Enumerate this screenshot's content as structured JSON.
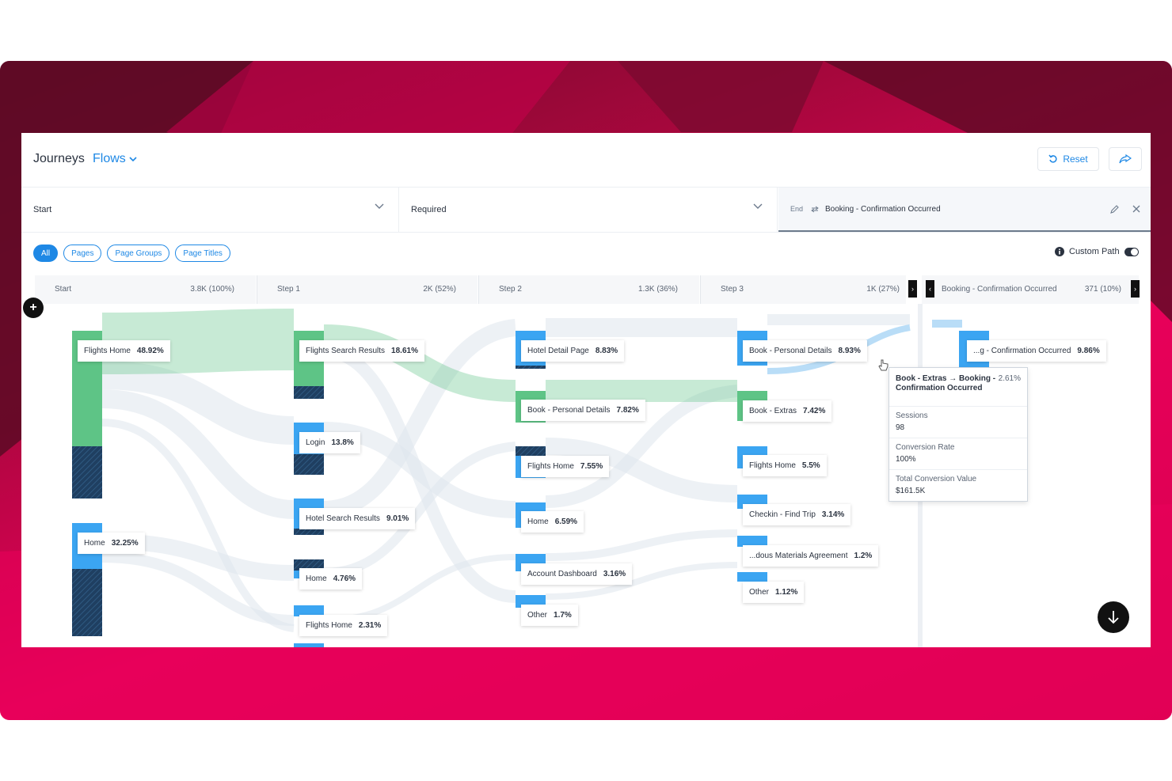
{
  "header": {
    "title": "Journeys",
    "view_label": "Flows",
    "reset_label": "Reset"
  },
  "filters": {
    "start_label": "Start",
    "required_label": "Required",
    "end_tag": "End",
    "end_value": "Booking - Confirmation Occurred"
  },
  "pills": [
    "All",
    "Pages",
    "Page Groups",
    "Page Titles"
  ],
  "custom_path_label": "Custom Path",
  "steps": [
    {
      "name": "Start",
      "count": "3.8K (100%)"
    },
    {
      "name": "Step 1",
      "count": "2K (52%)"
    },
    {
      "name": "Step 2",
      "count": "1.3K (36%)"
    },
    {
      "name": "Step 3",
      "count": "1K (27%)"
    },
    {
      "name": "Booking - Confirmation Occurred",
      "count": "371 (10%)"
    }
  ],
  "nav": {
    "next": "›",
    "prev": "‹"
  },
  "nodes": {
    "start": [
      {
        "label": "Flights Home",
        "pct": "48.92%"
      },
      {
        "label": "Home",
        "pct": "32.25%"
      }
    ],
    "step1": [
      {
        "label": "Flights Search Results",
        "pct": "18.61%"
      },
      {
        "label": "Login",
        "pct": "13.8%"
      },
      {
        "label": "Hotel Search Results",
        "pct": "9.01%"
      },
      {
        "label": "Home",
        "pct": "4.76%"
      },
      {
        "label": "Flights Home",
        "pct": "2.31%"
      }
    ],
    "step2": [
      {
        "label": "Hotel Detail Page",
        "pct": "8.83%"
      },
      {
        "label": "Book - Personal Details",
        "pct": "7.82%"
      },
      {
        "label": "Flights Home",
        "pct": "7.55%"
      },
      {
        "label": "Home",
        "pct": "6.59%"
      },
      {
        "label": "Account Dashboard",
        "pct": "3.16%"
      },
      {
        "label": "Other",
        "pct": "1.7%"
      }
    ],
    "step3": [
      {
        "label": "Book - Personal Details",
        "pct": "8.93%"
      },
      {
        "label": "Book - Extras",
        "pct": "7.42%"
      },
      {
        "label": "Flights Home",
        "pct": "5.5%"
      },
      {
        "label": "Checkin - Find Trip",
        "pct": "3.14%"
      },
      {
        "label": "...dous Materials Agreement",
        "pct": "1.2%"
      },
      {
        "label": "Other",
        "pct": "1.12%"
      }
    ],
    "end": [
      {
        "label": "...g - Confirmation Occurred",
        "pct": "9.86%"
      }
    ]
  },
  "tooltip": {
    "title": "Book - Extras → Booking - Confirmation Occurred",
    "pct": "2.61%",
    "rows": [
      {
        "k": "Sessions",
        "v": "98"
      },
      {
        "k": "Conversion Rate",
        "v": "100%"
      },
      {
        "k": "Total Conversion Value",
        "v": "$161.5K"
      }
    ]
  },
  "colors": {
    "accent": "#1e88e5",
    "green": "#5ec486",
    "navy": "#1f3f61",
    "magenta": "#e8005a"
  }
}
